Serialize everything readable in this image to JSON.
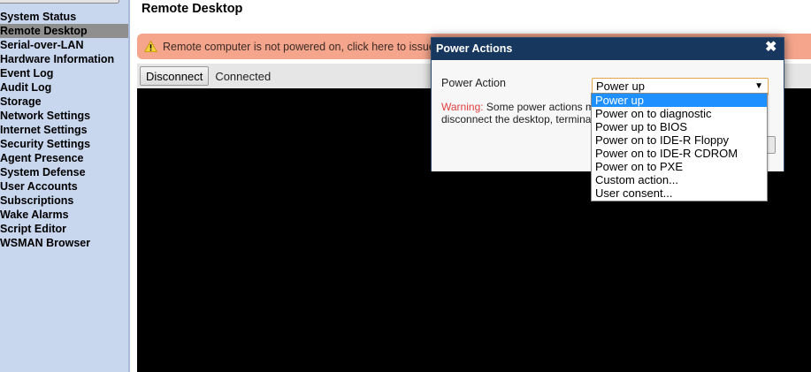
{
  "sidebar": {
    "items": [
      {
        "label": "System Status",
        "active": false
      },
      {
        "label": "Remote Desktop",
        "active": true
      },
      {
        "label": "Serial-over-LAN",
        "active": false
      },
      {
        "label": "Hardware Information",
        "active": false
      },
      {
        "label": "Event Log",
        "active": false
      },
      {
        "label": "Audit Log",
        "active": false
      },
      {
        "label": "Storage",
        "active": false
      },
      {
        "label": "Network Settings",
        "active": false
      },
      {
        "label": "Internet Settings",
        "active": false
      },
      {
        "label": "Security Settings",
        "active": false
      },
      {
        "label": "Agent Presence",
        "active": false
      },
      {
        "label": "System Defense",
        "active": false
      },
      {
        "label": "User Accounts",
        "active": false
      },
      {
        "label": "Subscriptions",
        "active": false
      },
      {
        "label": "Wake Alarms",
        "active": false
      },
      {
        "label": "Script Editor",
        "active": false
      },
      {
        "label": "WSMAN Browser",
        "active": false
      }
    ]
  },
  "page": {
    "title": "Remote Desktop"
  },
  "banner": {
    "text": "Remote computer is not powered on, click here to issue",
    "icon": "warning-triangle-icon",
    "color": "#f5a58c"
  },
  "toolbar": {
    "disconnect_label": "Disconnect",
    "status": "Connected"
  },
  "dialog": {
    "title": "Power Actions",
    "field_label": "Power Action",
    "selected_value": "Power up",
    "warning_label": "Warning:",
    "warning_line1": "Some power actions m",
    "warning_line2": "disconnect the desktop, termina",
    "options": [
      "Power up",
      "Power on to diagnostic",
      "Power up to BIOS",
      "Power on to IDE-R Floppy",
      "Power on to IDE-R CDROM",
      "Power on to PXE",
      "Custom action...",
      "User consent..."
    ],
    "header_color": "#17375e",
    "highlight_color": "#1e90ff"
  }
}
